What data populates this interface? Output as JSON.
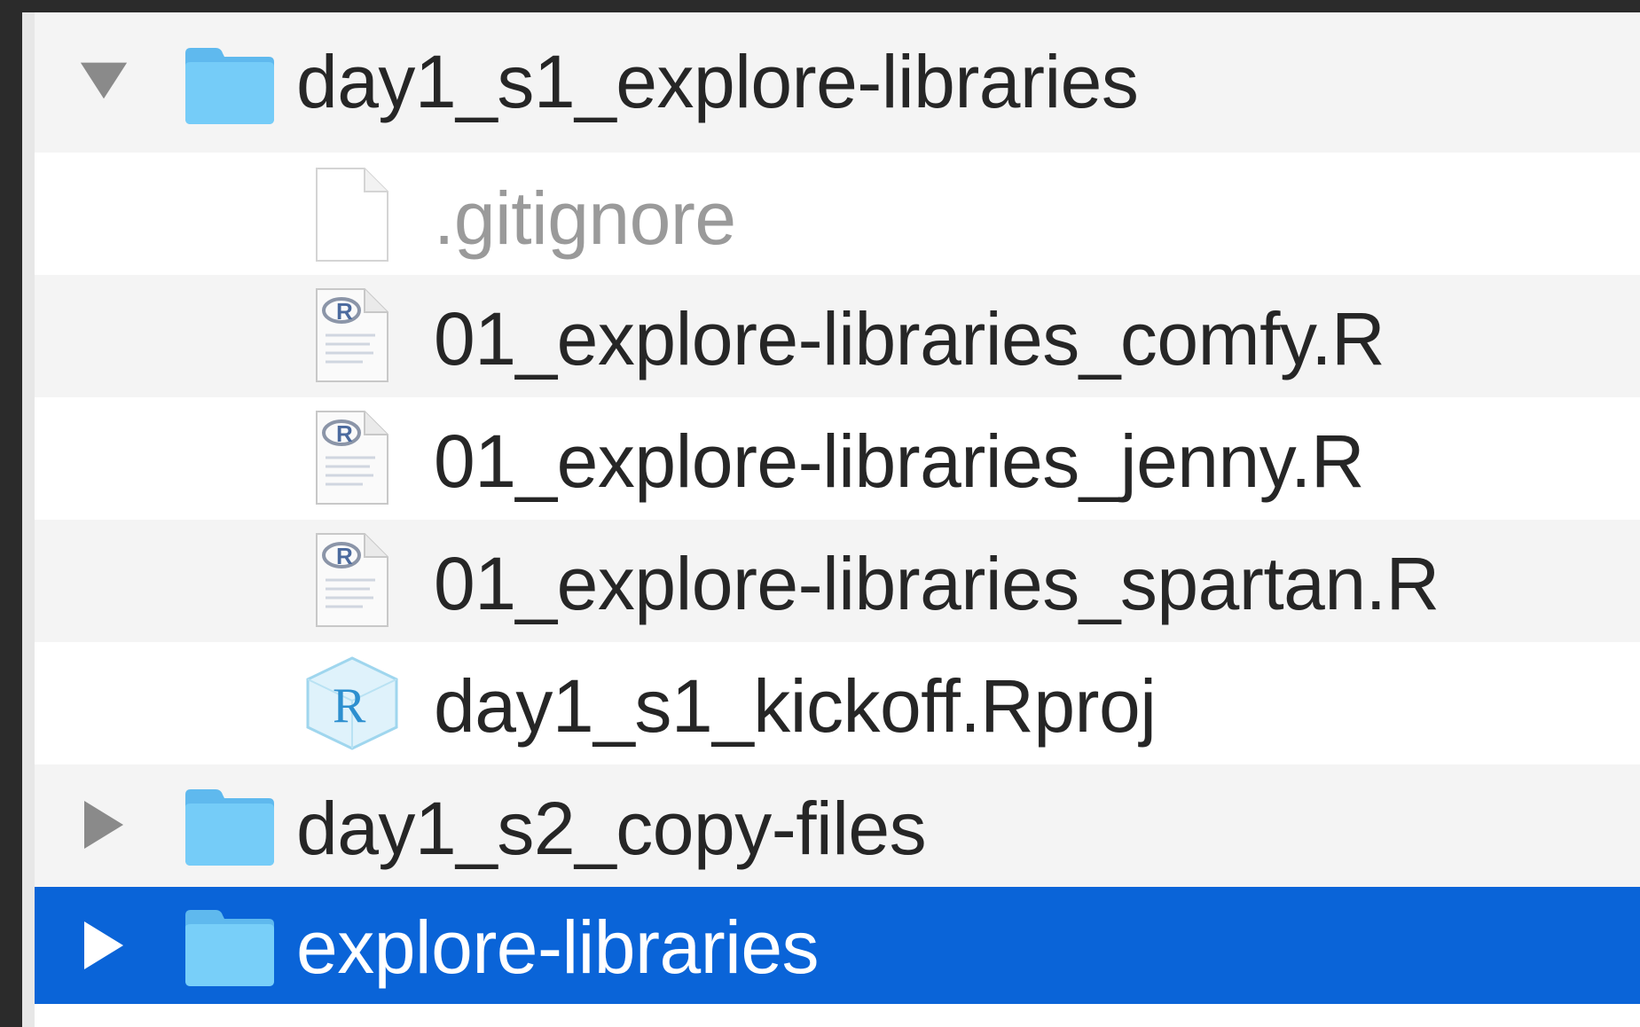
{
  "file_tree": {
    "items": [
      {
        "name": "day1_s1_explore-libraries",
        "kind": "folder",
        "expanded": true,
        "icon": "folder-icon"
      },
      {
        "name": ".gitignore",
        "kind": "file",
        "icon": "blank-document-icon"
      },
      {
        "name": "01_explore-libraries_comfy.R",
        "kind": "file",
        "icon": "r-script-icon"
      },
      {
        "name": "01_explore-libraries_jenny.R",
        "kind": "file",
        "icon": "r-script-icon"
      },
      {
        "name": "01_explore-libraries_spartan.R",
        "kind": "file",
        "icon": "r-script-icon"
      },
      {
        "name": "day1_s1_kickoff.Rproj",
        "kind": "file",
        "icon": "r-project-icon"
      },
      {
        "name": "day1_s2_copy-files",
        "kind": "folder",
        "expanded": false,
        "icon": "folder-icon"
      },
      {
        "name": "explore-libraries",
        "kind": "folder",
        "expanded": false,
        "selected": true,
        "icon": "folder-icon"
      }
    ]
  },
  "colors": {
    "selection": "#0a64d8",
    "folder": "#6cc4f5",
    "stripe": "#f4f4f4",
    "background": "#2b2b2b"
  }
}
